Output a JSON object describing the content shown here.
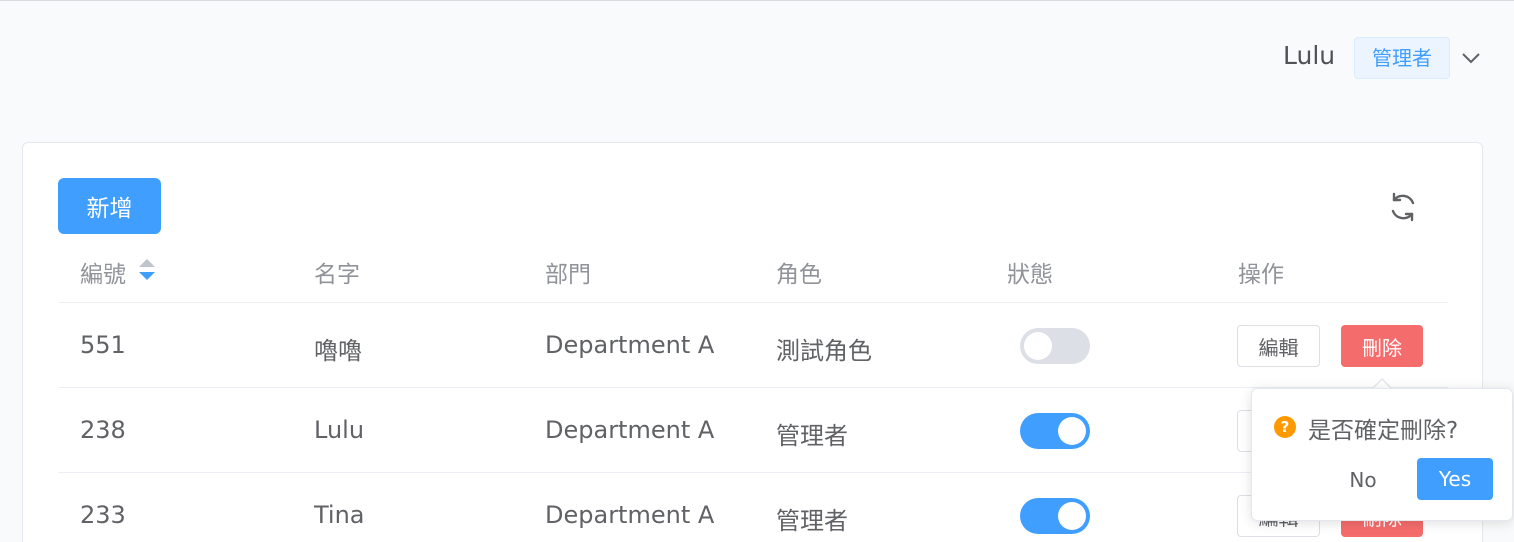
{
  "header": {
    "user_name": "Lulu",
    "role": "管理者"
  },
  "toolbar": {
    "add_label": "新增"
  },
  "table": {
    "columns": [
      "編號",
      "名字",
      "部門",
      "角色",
      "狀態",
      "操作"
    ],
    "rows": [
      {
        "id": "551",
        "name": "嚕嚕",
        "department": "Department A",
        "role": "測試角色",
        "enabled": false
      },
      {
        "id": "238",
        "name": "Lulu",
        "department": "Department A",
        "role": "管理者",
        "enabled": true
      },
      {
        "id": "233",
        "name": "Tina",
        "department": "Department A",
        "role": "管理者",
        "enabled": true
      }
    ],
    "edit_label": "編輯",
    "delete_label": "刪除"
  },
  "popconfirm": {
    "message": "是否確定刪除?",
    "no_label": "No",
    "yes_label": "Yes"
  },
  "colors": {
    "primary": "#409eff",
    "danger": "#f56c6c",
    "warning": "#ff9900"
  },
  "icons": {
    "dropdown": "chevron-down-icon",
    "refresh": "refresh-icon",
    "sort": "sort-icon",
    "question": "question-icon"
  }
}
